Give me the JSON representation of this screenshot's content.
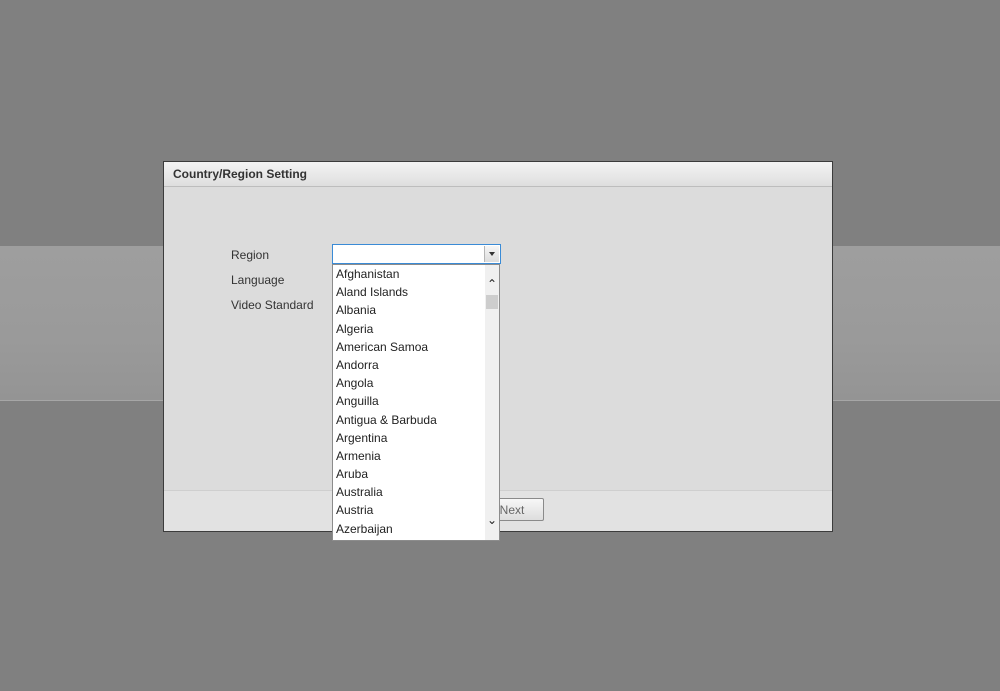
{
  "dialog": {
    "title": "Country/Region Setting",
    "next_label": "Next"
  },
  "form": {
    "region_label": "Region",
    "language_label": "Language",
    "video_standard_label": "Video Standard",
    "region_value": ""
  },
  "dropdown": {
    "options": [
      "Afghanistan",
      "Aland Islands",
      "Albania",
      "Algeria",
      "American Samoa",
      "Andorra",
      "Angola",
      "Anguilla",
      "Antigua & Barbuda",
      "Argentina",
      "Armenia",
      "Aruba",
      "Australia",
      "Austria",
      "Azerbaijan"
    ]
  },
  "icons": {
    "select_arrow": "chevron-down-icon",
    "scroll_up": "chevron-up-icon",
    "scroll_down": "chevron-down-icon"
  },
  "colors": {
    "focus_border": "#3a8bd6",
    "backdrop": "#808080"
  }
}
